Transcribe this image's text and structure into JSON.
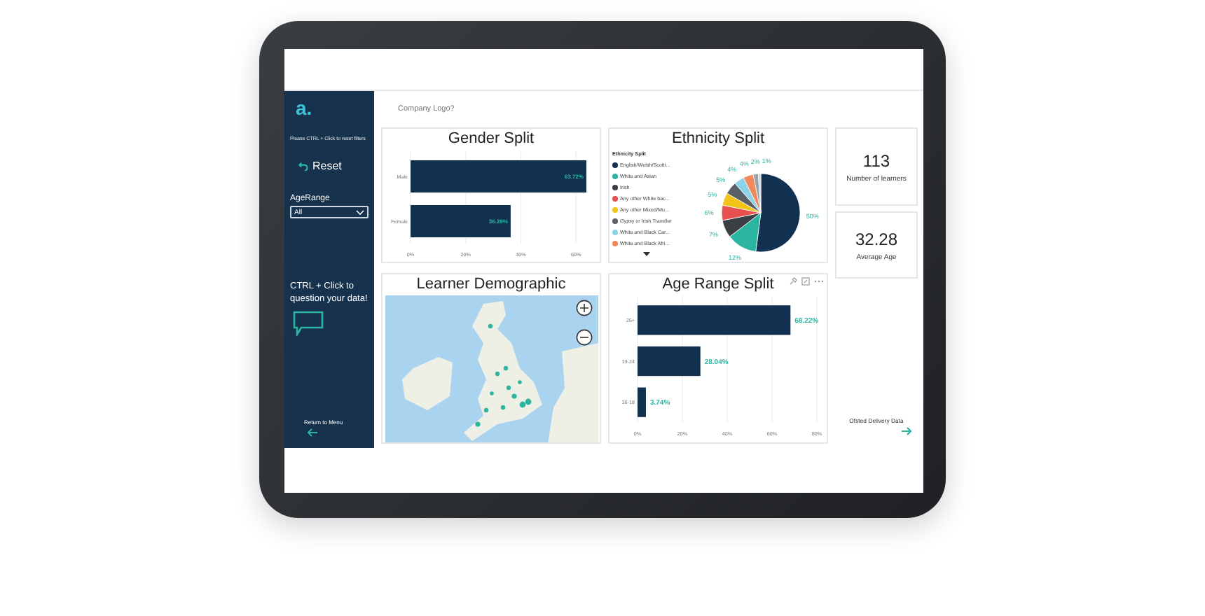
{
  "sidebar": {
    "logo": "a.",
    "reset_hint": "Please CTRL + Click to reset filters",
    "reset_button": "Reset",
    "filter": {
      "label": "AgeRange",
      "value": "All"
    },
    "qa_hint": "CTRL + Click to question your data!",
    "return_link": "Return to Menu"
  },
  "header": {
    "logo_text": "Company Logo?"
  },
  "gender_split": {
    "title": "Gender Split",
    "chart_data": {
      "type": "bar",
      "orientation": "horizontal",
      "grid": true,
      "categories": [
        "Male",
        "Female"
      ],
      "values": [
        63.72,
        36.28
      ],
      "value_labels": [
        "63.72%",
        "36.28%"
      ],
      "xlim": [
        0,
        65
      ],
      "xticks": [
        {
          "value": 0,
          "label": "0%"
        },
        {
          "value": 20,
          "label": "20%"
        },
        {
          "value": 40,
          "label": "40%"
        },
        {
          "value": 60,
          "label": "60%"
        }
      ]
    }
  },
  "ethnicity_split": {
    "title": "Ethnicity Split",
    "legend_title": "Ethnicity Split",
    "legend": [
      {
        "label": "English/Welsh/Scotti...",
        "color": "#12304f"
      },
      {
        "label": "White and Asian",
        "color": "#2bb5a0"
      },
      {
        "label": "Irish",
        "color": "#3a3f44"
      },
      {
        "label": "Any other White bac...",
        "color": "#e8504f"
      },
      {
        "label": "Any other Mixed/Mu...",
        "color": "#f2c318"
      },
      {
        "label": "Gypsy or Irish Traveller",
        "color": "#5a6066"
      },
      {
        "label": "White and Black Car...",
        "color": "#8dd3e8"
      },
      {
        "label": "White and Black Afri...",
        "color": "#f08a5d"
      }
    ],
    "chart_data": {
      "type": "pie",
      "values": [
        50,
        12,
        7,
        6,
        5,
        5,
        4,
        4,
        2,
        1
      ],
      "value_labels": [
        "50%",
        "12%",
        "7%",
        "6%",
        "5%",
        "5%",
        "4%",
        "4%",
        "2%",
        "1%"
      ],
      "colors": [
        "#12304f",
        "#2bb5a0",
        "#3a3f44",
        "#e8504f",
        "#f2c318",
        "#5a6066",
        "#8dd3e8",
        "#f08a5d",
        "#9aa3ab",
        "#c9d3da"
      ]
    }
  },
  "learner_demographic": {
    "title": "Learner Demographic"
  },
  "age_range_split": {
    "title": "Age Range Split",
    "chart_data": {
      "type": "bar",
      "orientation": "horizontal",
      "grid": true,
      "categories": [
        "25+",
        "19-24",
        "16-18"
      ],
      "values": [
        68.22,
        28.04,
        3.74
      ],
      "value_labels": [
        "68.22%",
        "28.04%",
        "3.74%"
      ],
      "xlim": [
        0,
        80
      ],
      "xticks": [
        {
          "value": 0,
          "label": "0%"
        },
        {
          "value": 20,
          "label": "20%"
        },
        {
          "value": 40,
          "label": "40%"
        },
        {
          "value": 60,
          "label": "60%"
        },
        {
          "value": 80,
          "label": "80%"
        }
      ]
    }
  },
  "kpis": [
    {
      "value": "113",
      "label": "Number of learners"
    },
    {
      "value": "32.28",
      "label": "Average Age"
    }
  ],
  "ofsted_link": "Ofsted Delivery Data"
}
